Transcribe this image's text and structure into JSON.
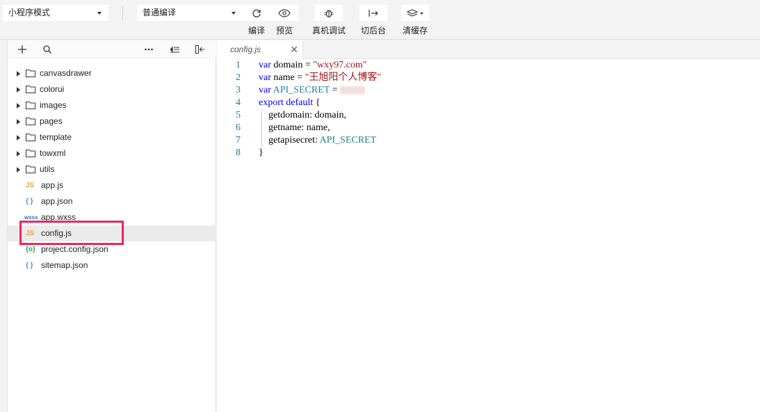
{
  "toolbar": {
    "mode_select": "小程序模式",
    "compile_select": "普通编译",
    "buttons": {
      "compile": "编译",
      "preview": "预览",
      "debug": "真机调试",
      "background": "切后台",
      "clear_cache": "清缓存"
    }
  },
  "sidebar": {
    "folders": [
      "canvasdrawer",
      "colorui",
      "images",
      "pages",
      "template",
      "towxml",
      "utils"
    ],
    "files": [
      {
        "name": "app.js",
        "icon": "JS",
        "color": "#e8a33b"
      },
      {
        "name": "app.json",
        "icon": "{ }",
        "color": "#2aa0d8"
      },
      {
        "name": "app.wxss",
        "icon": "wxss",
        "color": "#2b6fd1"
      },
      {
        "name": "config.js",
        "icon": "JS",
        "color": "#e8a33b"
      },
      {
        "name": "project.config.json",
        "icon": "{o}",
        "color": "#28a745"
      },
      {
        "name": "sitemap.json",
        "icon": "{ }",
        "color": "#2aa0d8"
      }
    ]
  },
  "editor": {
    "tab_name": "config.js",
    "close_glyph": "✕",
    "lines": [
      {
        "num": "1",
        "kw": "var",
        "rest": " domain = ",
        "str": "\"wxy97.com\""
      },
      {
        "num": "2",
        "kw": "var",
        "rest": " name = ",
        "str": "\"王旭阳个人博客\""
      },
      {
        "num": "3",
        "kw": "var",
        "teal": " API_SECRET",
        "rest": " = "
      },
      {
        "num": "4",
        "kw": "export default",
        "rest": " {"
      },
      {
        "num": "5",
        "rest": "    getdomain: domain,"
      },
      {
        "num": "6",
        "rest": "    getname: name,"
      },
      {
        "num": "7",
        "rest": "    getapisecret: ",
        "teal": "API_SECRET"
      },
      {
        "num": "8",
        "rest": "}"
      }
    ]
  },
  "colors": {
    "highlight": "#f0245a",
    "keyword": "#0000ff",
    "string": "#a31515",
    "line_number": "#237893"
  }
}
